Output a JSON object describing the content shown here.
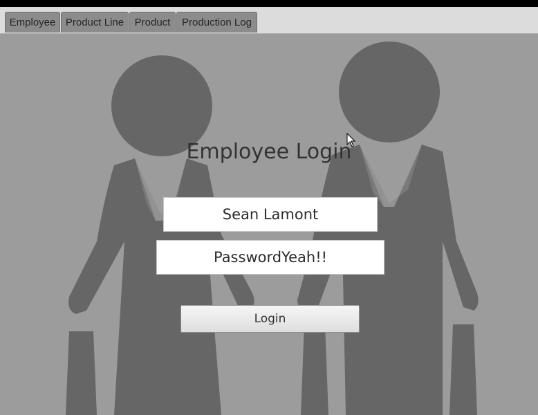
{
  "tabs": [
    {
      "label": "Employee"
    },
    {
      "label": "Product Line"
    },
    {
      "label": "Product"
    },
    {
      "label": "Production Log"
    }
  ],
  "login": {
    "title": "Employee Login",
    "username_value": "Sean Lamont",
    "password_value": "PasswordYeah!!",
    "login_label": "Login"
  },
  "colors": {
    "background": "#9c9c9c",
    "figures": "#666666",
    "tab": "#8c8c8c"
  },
  "icons": {
    "cursor": "mouse-pointer-icon"
  }
}
